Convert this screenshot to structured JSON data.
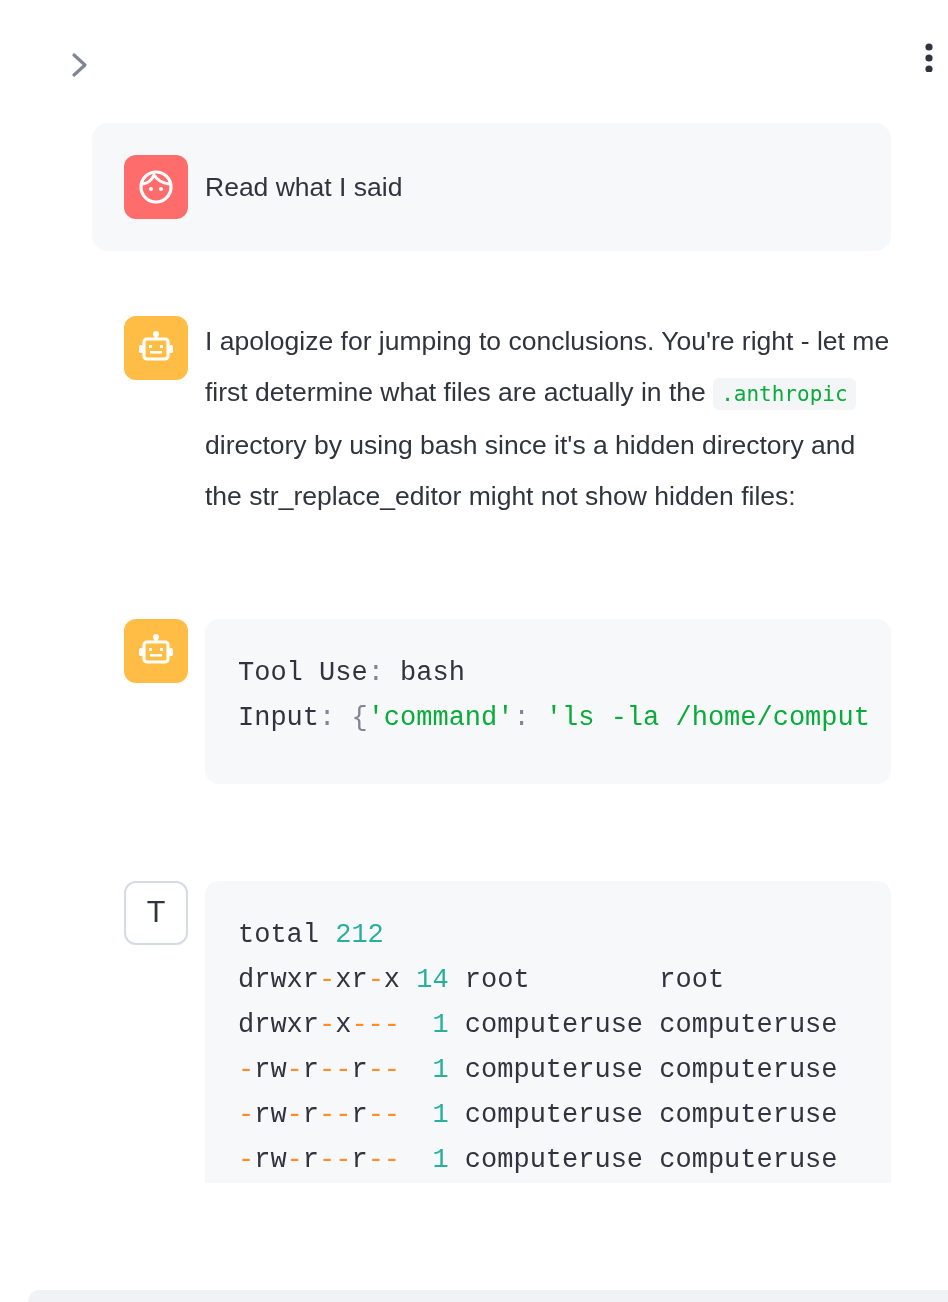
{
  "messages": [
    {
      "kind": "user",
      "segments": [
        {
          "kind": "text",
          "text": "Read what I said"
        }
      ]
    },
    {
      "kind": "reply",
      "segments": [
        {
          "kind": "text",
          "text": "I apologize for jumping to conclusions. You're right - let me first determine what files are actually in the "
        },
        {
          "kind": "code",
          "text": ".anthropic"
        },
        {
          "kind": "text",
          "text": " directory by using bash since it's a hidden directory and the str_replace_editor might not show hidden files:"
        }
      ]
    },
    {
      "kind": "tool_use",
      "lines": [
        [
          {
            "kind": "plain",
            "text": "Tool Use"
          },
          {
            "kind": "punct",
            "text": ":"
          },
          {
            "kind": "plain",
            "text": " bash"
          }
        ],
        [
          {
            "kind": "plain",
            "text": "Input"
          },
          {
            "kind": "punct",
            "text": ": {"
          },
          {
            "kind": "string",
            "text": "'command'"
          },
          {
            "kind": "punct",
            "text": ": "
          },
          {
            "kind": "string",
            "text": "'ls -la /home/comput"
          }
        ]
      ]
    },
    {
      "kind": "tool_result",
      "avatar_label": "T",
      "lines": [
        [
          {
            "kind": "plain",
            "text": "total "
          },
          {
            "kind": "number",
            "text": "212"
          }
        ],
        [
          {
            "kind": "plain",
            "text": "drwxr"
          },
          {
            "kind": "operator",
            "text": "-"
          },
          {
            "kind": "plain",
            "text": "xr"
          },
          {
            "kind": "operator",
            "text": "-"
          },
          {
            "kind": "plain",
            "text": "x "
          },
          {
            "kind": "number",
            "text": "14"
          },
          {
            "kind": "plain",
            "text": " root        root"
          }
        ],
        [
          {
            "kind": "plain",
            "text": "drwxr"
          },
          {
            "kind": "operator",
            "text": "-"
          },
          {
            "kind": "plain",
            "text": "x"
          },
          {
            "kind": "operator",
            "text": "---"
          },
          {
            "kind": "number",
            "text": "  1"
          },
          {
            "kind": "plain",
            "text": " computeruse computeruse"
          }
        ],
        [
          {
            "kind": "operator",
            "text": "-"
          },
          {
            "kind": "plain",
            "text": "rw"
          },
          {
            "kind": "operator",
            "text": "-"
          },
          {
            "kind": "plain",
            "text": "r"
          },
          {
            "kind": "operator",
            "text": "--"
          },
          {
            "kind": "plain",
            "text": "r"
          },
          {
            "kind": "operator",
            "text": "--"
          },
          {
            "kind": "number",
            "text": "  1"
          },
          {
            "kind": "plain",
            "text": " computeruse computeruse"
          }
        ],
        [
          {
            "kind": "operator",
            "text": "-"
          },
          {
            "kind": "plain",
            "text": "rw"
          },
          {
            "kind": "operator",
            "text": "-"
          },
          {
            "kind": "plain",
            "text": "r"
          },
          {
            "kind": "operator",
            "text": "--"
          },
          {
            "kind": "plain",
            "text": "r"
          },
          {
            "kind": "operator",
            "text": "--"
          },
          {
            "kind": "number",
            "text": "  1"
          },
          {
            "kind": "plain",
            "text": " computeruse computeruse"
          }
        ],
        [
          {
            "kind": "operator",
            "text": "-"
          },
          {
            "kind": "plain",
            "text": "rw"
          },
          {
            "kind": "operator",
            "text": "-"
          },
          {
            "kind": "plain",
            "text": "r"
          },
          {
            "kind": "operator",
            "text": "--"
          },
          {
            "kind": "plain",
            "text": "r"
          },
          {
            "kind": "operator",
            "text": "--"
          },
          {
            "kind": "number",
            "text": "  1"
          },
          {
            "kind": "plain",
            "text": " computeruse computeruse"
          }
        ]
      ]
    }
  ]
}
